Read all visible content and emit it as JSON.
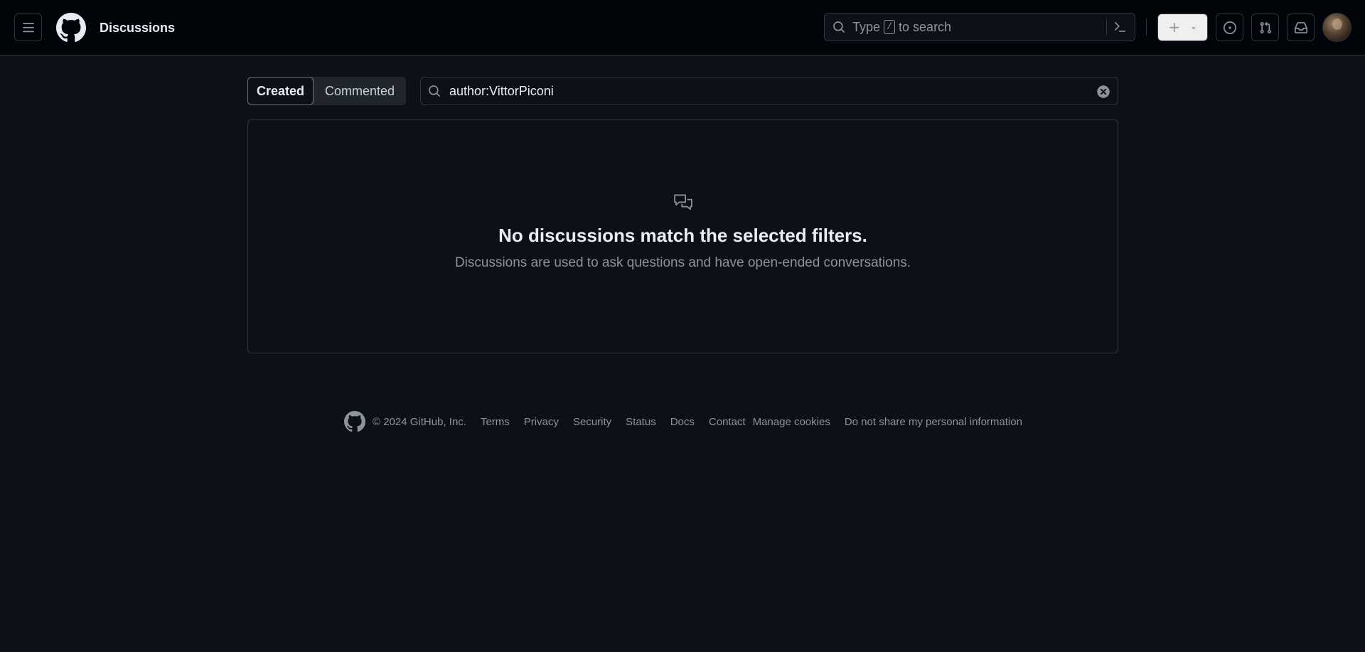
{
  "header": {
    "title": "Discussions",
    "search": {
      "prefix": "Type",
      "key": "/",
      "suffix": "to search"
    }
  },
  "filters": {
    "tabs": [
      {
        "label": "Created",
        "active": true
      },
      {
        "label": "Commented",
        "active": false
      }
    ],
    "query": "author:VittorPiconi"
  },
  "blankslate": {
    "heading": "No discussions match the selected filters.",
    "description": "Discussions are used to ask questions and have open-ended conversations."
  },
  "footer": {
    "copyright": "© 2024 GitHub, Inc.",
    "links": [
      "Terms",
      "Privacy",
      "Security",
      "Status",
      "Docs",
      "Contact",
      "Manage cookies",
      "Do not share my personal information"
    ]
  },
  "colors": {
    "background": "#0d1117",
    "header_bg": "#010409",
    "border": "#30363d",
    "muted": "#8b949e",
    "text": "#e6edf3"
  },
  "icons": [
    "menu-icon",
    "github-logo-icon",
    "search-icon",
    "command-palette-icon",
    "plus-icon",
    "triangle-down-icon",
    "issue-icon",
    "pull-request-icon",
    "inbox-icon",
    "discussion-icon",
    "clear-icon"
  ]
}
